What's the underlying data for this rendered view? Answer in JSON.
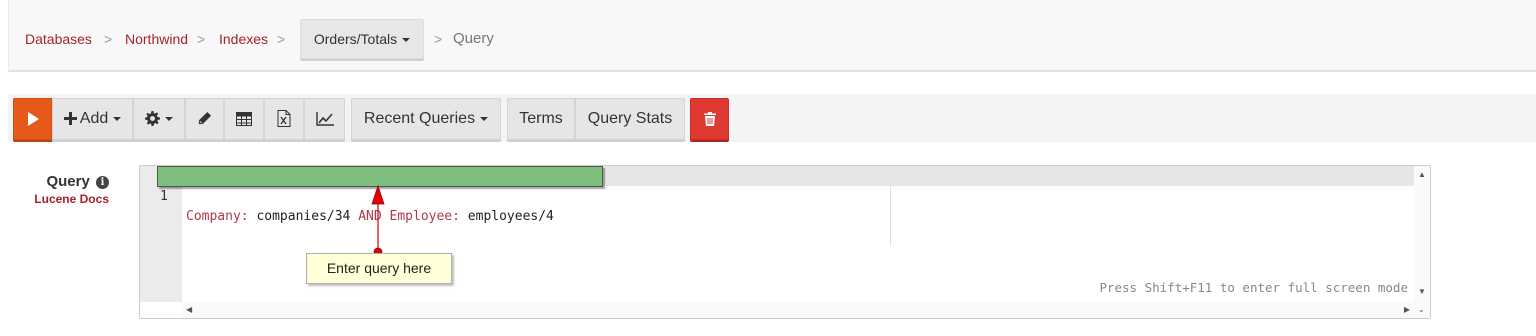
{
  "breadcrumb": {
    "items": [
      "Databases",
      "Northwind",
      "Indexes"
    ],
    "separator": ">",
    "index_dropdown": "Orders/Totals",
    "current": "Query"
  },
  "toolbar": {
    "run_icon": "play-icon",
    "add_label": "Add",
    "settings_icon": "gear-icon",
    "edit_icon": "pencil-icon",
    "table_icon": "table-icon",
    "excel_icon": "excel-icon",
    "chart_icon": "chart-icon",
    "recent_queries_label": "Recent Queries",
    "terms_label": "Terms",
    "query_stats_label": "Query Stats",
    "delete_icon": "trash-icon"
  },
  "query_panel": {
    "label": "Query",
    "info_icon": "info-icon",
    "docs_link": "Lucene Docs"
  },
  "editor": {
    "line_number": "1",
    "tokens": [
      {
        "text": "Company:",
        "type": "kw"
      },
      {
        "text": " companies/34 ",
        "type": "val"
      },
      {
        "text": "AND",
        "type": "kw"
      },
      {
        "text": " Employee:",
        "type": "kw"
      },
      {
        "text": " employees/4",
        "type": "val"
      }
    ],
    "fullscreen_hint": "Press Shift+F11 to enter full screen mode"
  },
  "callout": {
    "text": "Enter query here"
  },
  "colors": {
    "accent": "#a5232b",
    "run": "#e55a1b",
    "delete": "#de3a32",
    "highlight": "#7dbf7d",
    "callout_bg": "#ffffd8"
  }
}
